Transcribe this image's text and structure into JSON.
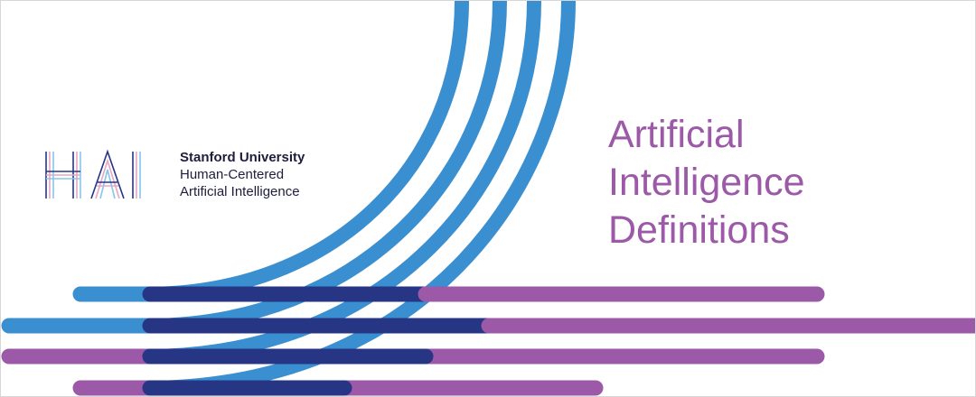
{
  "logo": {
    "mark_text": "HAI",
    "university": "Stanford University",
    "line2": "Human-Centered",
    "line3": "Artificial Intelligence"
  },
  "title": {
    "line1": "Artificial",
    "line2": "Intelligence",
    "line3": "Definitions"
  },
  "colors": {
    "blue": "#3a8fd0",
    "navy": "#273585",
    "purple": "#9b59a7",
    "pink": "#e7a6c2",
    "light_blue": "#86c6ea",
    "logo_navy": "#1e1e3c"
  }
}
